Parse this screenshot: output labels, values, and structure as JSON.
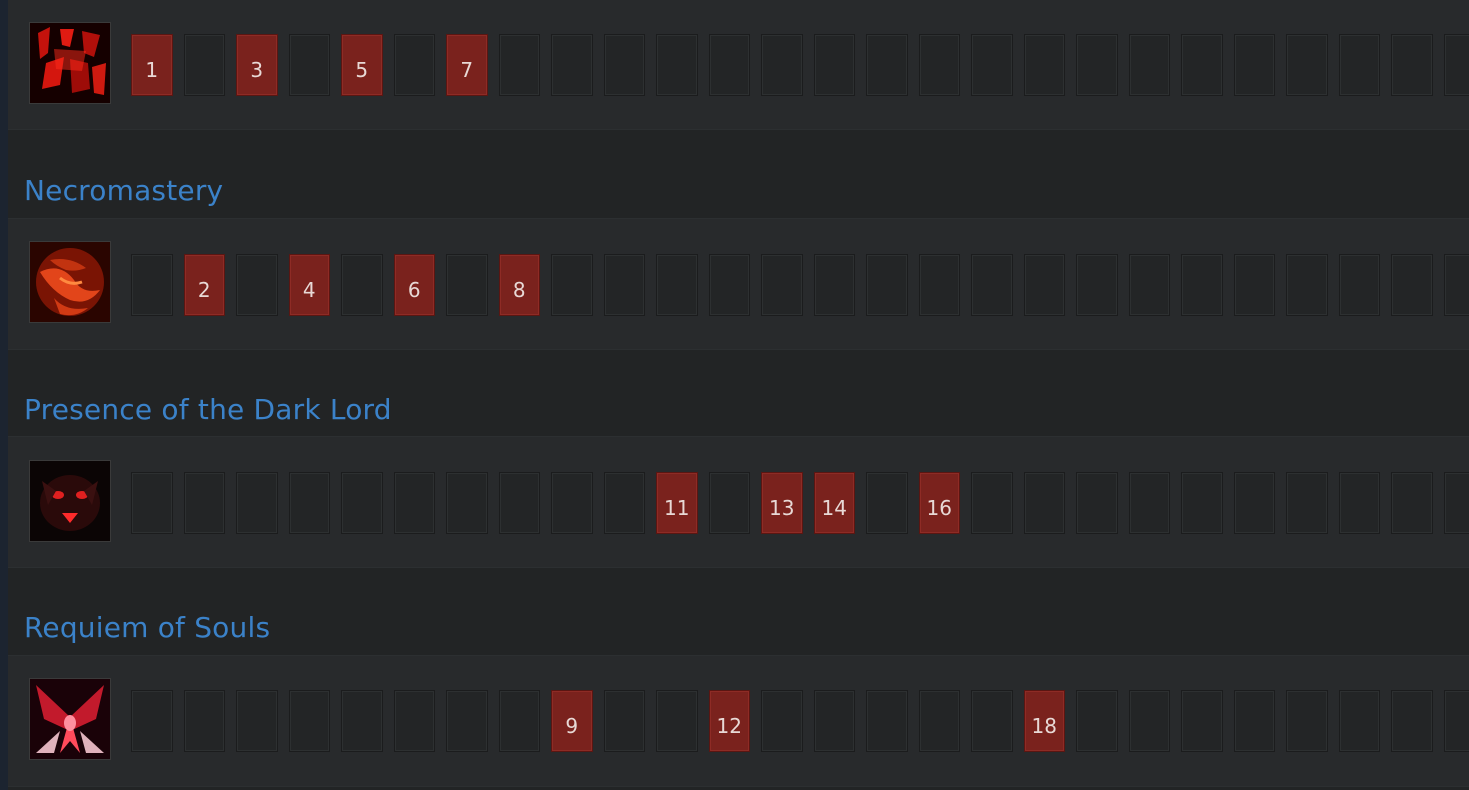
{
  "abilities": [
    {
      "name": "",
      "icon": "ability-1-icon",
      "levels": [
        "1",
        "",
        "3",
        "",
        "5",
        "",
        "7",
        "",
        "",
        "",
        "",
        "",
        "",
        "",
        "",
        "",
        "",
        "",
        "",
        "",
        "",
        "",
        "",
        "",
        "",
        ""
      ]
    },
    {
      "name": "Necromastery",
      "icon": "necromastery-icon",
      "levels": [
        "",
        "2",
        "",
        "4",
        "",
        "6",
        "",
        "8",
        "",
        "",
        "",
        "",
        "",
        "",
        "",
        "",
        "",
        "",
        "",
        "",
        "",
        "",
        "",
        "",
        "",
        ""
      ]
    },
    {
      "name": "Presence of the Dark Lord",
      "icon": "presence-of-the-dark-lord-icon",
      "levels": [
        "",
        "",
        "",
        "",
        "",
        "",
        "",
        "",
        "",
        "",
        "11",
        "",
        "13",
        "14",
        "",
        "16",
        "",
        "",
        "",
        "",
        "",
        "",
        "",
        "",
        "",
        ""
      ]
    },
    {
      "name": "Requiem of Souls",
      "icon": "requiem-of-souls-icon",
      "levels": [
        "",
        "",
        "",
        "",
        "",
        "",
        "",
        "",
        "9",
        "",
        "",
        "12",
        "",
        "",
        "",
        "",
        "",
        "18",
        "",
        "",
        "",
        "",
        "",
        "",
        "",
        ""
      ]
    }
  ],
  "colors": {
    "active_slot": "#7a221d",
    "title": "#3b82c9"
  }
}
